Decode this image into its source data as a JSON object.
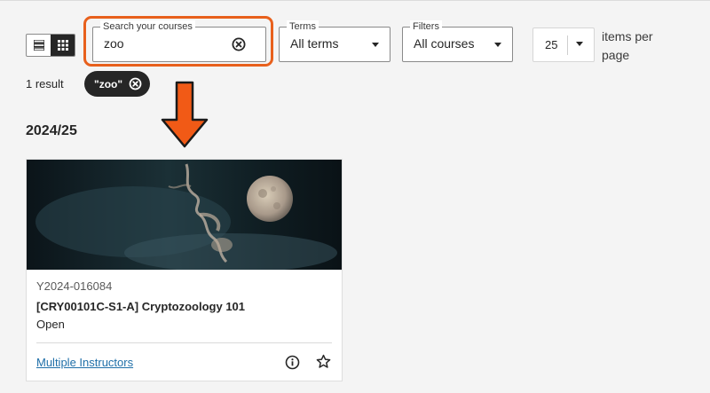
{
  "view_toggle": {
    "list_icon": "list-view-icon",
    "grid_icon": "grid-view-icon",
    "active": "grid"
  },
  "search": {
    "label": "Search your courses",
    "value": "zoo",
    "clear_icon": "clear-circle-x-icon",
    "highlight_color": "#e8601c"
  },
  "terms": {
    "label": "Terms",
    "value": "All terms"
  },
  "filters": {
    "label": "Filters",
    "value": "All courses"
  },
  "pagination": {
    "per_page": "25",
    "label": "items per page"
  },
  "results": {
    "count_text": "1 result",
    "chip_label": "\"zoo\"",
    "chip_icon": "remove-filter-icon"
  },
  "annotation": {
    "arrow_icon": "down-arrow-icon",
    "color": "#f15a16"
  },
  "term_heading": "2024/25",
  "course_card": {
    "id": "Y2024-016084",
    "title": "[CRY00101C-S1-A] Cryptozoology 101",
    "status": "Open",
    "instructors_link": "Multiple Instructors",
    "info_icon": "info-icon",
    "favorite_icon": "star-outline-icon",
    "link_color": "#1f6fa8"
  }
}
